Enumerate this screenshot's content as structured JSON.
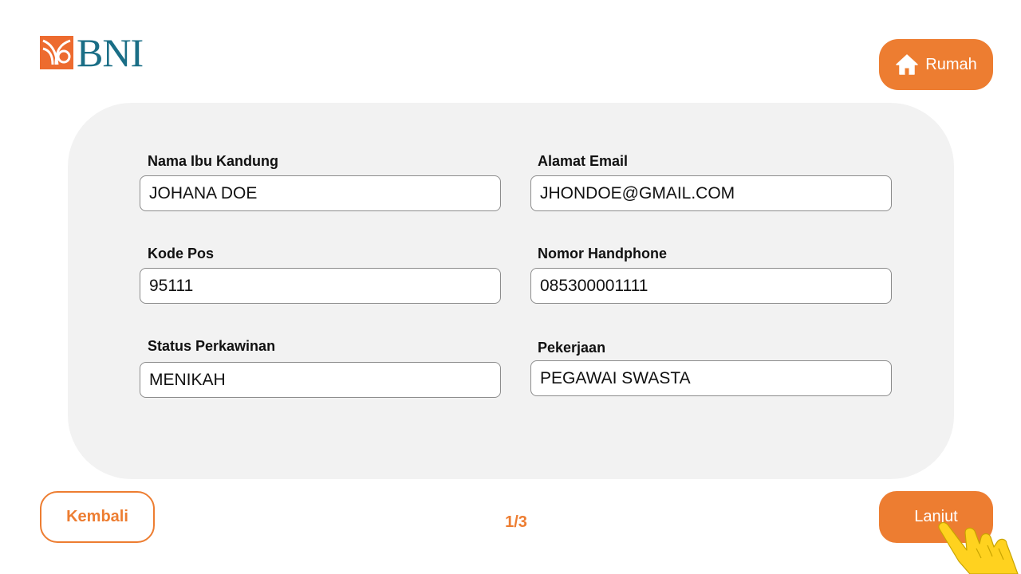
{
  "brand": {
    "name": "BNI",
    "accent": "#ed7d31",
    "logo_color": "#1a6e86"
  },
  "header": {
    "home_label": "Rumah",
    "home_icon": "home-icon"
  },
  "form": {
    "fields": [
      {
        "label": "Nama Ibu Kandung",
        "value": "JOHANA DOE"
      },
      {
        "label": "Alamat Email",
        "value": "JHONDOE@GMAIL.COM"
      },
      {
        "label": "Kode Pos",
        "value": "95111"
      },
      {
        "label": "Nomor Handphone",
        "value": "085300001111"
      },
      {
        "label": "Status Perkawinan",
        "value": "MENIKAH"
      },
      {
        "label": "Pekerjaan",
        "value": "PEGAWAI SWASTA"
      }
    ]
  },
  "footer": {
    "back_label": "Kembali",
    "page_indicator": "1/3",
    "next_label": "Lanjut"
  },
  "pointer": {
    "icon": "hand-pointer-icon"
  }
}
